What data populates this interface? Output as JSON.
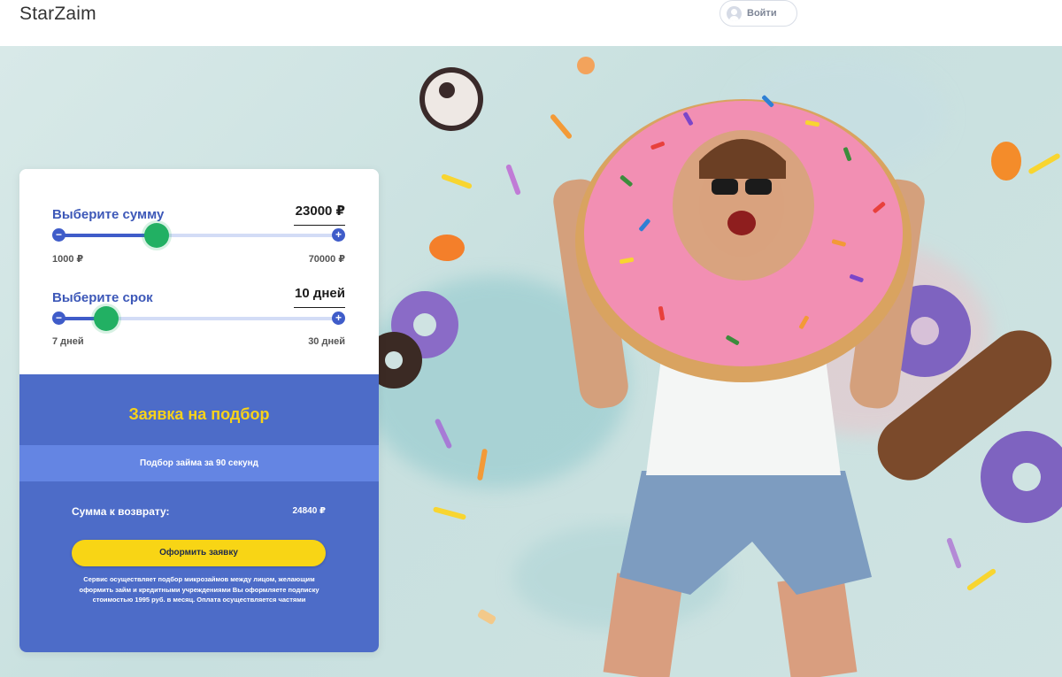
{
  "header": {
    "logo": "StarZaim",
    "login_label": "Войти"
  },
  "calculator": {
    "amount": {
      "label": "Выберите сумму",
      "value": "23000 ₽",
      "min": "1000 ₽",
      "max": "70000 ₽",
      "position": 0.35
    },
    "term": {
      "label": "Выберите срок",
      "value": "10 дней",
      "min": "7 дней",
      "max": "30 дней",
      "position": 0.17
    },
    "minus_symbol": "−",
    "plus_symbol": "+"
  },
  "application": {
    "title": "Заявка на подбор",
    "promo": "Подбор займа за 90 секунд",
    "return_label": "Сумма к возврату:",
    "return_value": "24840 ₽",
    "submit_label": "Оформить заявку",
    "disclaimer": "Сервис осуществляет подбор микрозаймов между лицом, желающим оформить займ и кредитными учреждениями Вы оформляете подписку стоимостью 1995 руб. в месяц. Оплата осуществляется частями"
  },
  "colors": {
    "accent_blue": "#3f5cc9",
    "card_blue": "#4d6cc8",
    "strip_blue": "#6485e3",
    "yellow": "#f8d515",
    "thumb_green": "#22b063"
  },
  "icons": {
    "login": "user-icon",
    "minus": "minus-icon",
    "plus": "plus-icon"
  }
}
